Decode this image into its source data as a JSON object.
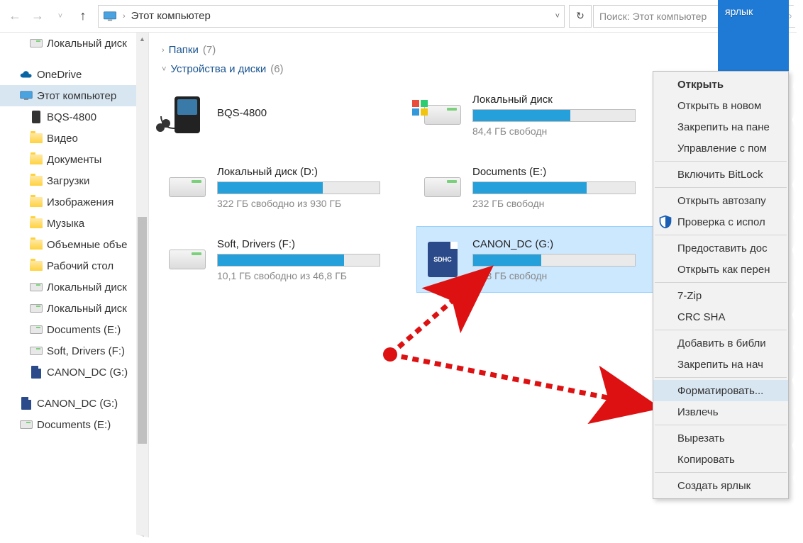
{
  "addressbar": {
    "location": "Этот компьютер",
    "search_placeholder": "Поиск: Этот компьютер"
  },
  "desktop_peek_label": "ярлык",
  "sidebar": {
    "items": [
      {
        "label": "Локальный диск",
        "kind": "disk",
        "indent": 1
      },
      {
        "label": "OneDrive",
        "kind": "onedrive",
        "indent": 0
      },
      {
        "label": "Этот компьютер",
        "kind": "pc",
        "indent": 0,
        "selected": true
      },
      {
        "label": "BQS-4800",
        "kind": "mp3",
        "indent": 1
      },
      {
        "label": "Видео",
        "kind": "folder",
        "indent": 1
      },
      {
        "label": "Документы",
        "kind": "folder",
        "indent": 1
      },
      {
        "label": "Загрузки",
        "kind": "folder",
        "indent": 1
      },
      {
        "label": "Изображения",
        "kind": "folder",
        "indent": 1
      },
      {
        "label": "Музыка",
        "kind": "folder",
        "indent": 1
      },
      {
        "label": "Объемные объе",
        "kind": "folder",
        "indent": 1
      },
      {
        "label": "Рабочий стол",
        "kind": "folder",
        "indent": 1
      },
      {
        "label": "Локальный диск",
        "kind": "disk",
        "indent": 1
      },
      {
        "label": "Локальный диск",
        "kind": "disk",
        "indent": 1
      },
      {
        "label": "Documents (E:)",
        "kind": "disk",
        "indent": 1
      },
      {
        "label": "Soft, Drivers (F:)",
        "kind": "disk",
        "indent": 1
      },
      {
        "label": "CANON_DC (G:)",
        "kind": "sd",
        "indent": 1
      },
      {
        "label": "CANON_DC (G:)",
        "kind": "sd",
        "indent": 0
      },
      {
        "label": "Documents (E:)",
        "kind": "disk",
        "indent": 0
      }
    ]
  },
  "groups": {
    "folders": {
      "label": "Папки",
      "count": "(7)",
      "expanded": false
    },
    "devices": {
      "label": "Устройства и диски",
      "count": "(6)",
      "expanded": true
    }
  },
  "drives": [
    {
      "name": "BQS-4800",
      "icon": "mp3",
      "free": "",
      "fill": 0,
      "bar": false
    },
    {
      "name": "Локальный диск",
      "icon": "diskwin",
      "free": "84,4 ГБ свободн",
      "fill": 60,
      "bar": true
    },
    {
      "name": "Локальный диск (D:)",
      "icon": "disk",
      "free": "322 ГБ свободно из 930 ГБ",
      "fill": 65,
      "bar": true
    },
    {
      "name": "Documents (E:)",
      "icon": "disk",
      "free": "232 ГБ свободн",
      "fill": 70,
      "bar": true
    },
    {
      "name": "Soft, Drivers (F:)",
      "icon": "disk",
      "free": "10,1 ГБ свободно из 46,8 ГБ",
      "fill": 78,
      "bar": true
    },
    {
      "name": "CANON_DC (G:)",
      "icon": "sd",
      "free": "4,33 ГБ свободн",
      "fill": 42,
      "bar": true,
      "selected": true
    }
  ],
  "context_menu": [
    {
      "label": "Открыть",
      "bold": true
    },
    {
      "label": "Открыть в новом"
    },
    {
      "label": "Закрепить на пане"
    },
    {
      "label": "Управление с пом"
    },
    {
      "sep": true
    },
    {
      "label": "Включить BitLock"
    },
    {
      "sep": true
    },
    {
      "label": "Открыть автозапу"
    },
    {
      "label": "Проверка с испол",
      "icon": "shield"
    },
    {
      "sep": true
    },
    {
      "label": "Предоставить дос"
    },
    {
      "label": "Открыть как перен"
    },
    {
      "sep": true
    },
    {
      "label": "7-Zip"
    },
    {
      "label": "CRC SHA"
    },
    {
      "sep": true
    },
    {
      "label": "Добавить в библи"
    },
    {
      "label": "Закрепить на нач"
    },
    {
      "sep": true
    },
    {
      "label": "Форматировать...",
      "highlight": true
    },
    {
      "label": "Извлечь"
    },
    {
      "sep": true
    },
    {
      "label": "Вырезать"
    },
    {
      "label": "Копировать"
    },
    {
      "sep": true
    },
    {
      "label": "Создать ярлык"
    }
  ]
}
